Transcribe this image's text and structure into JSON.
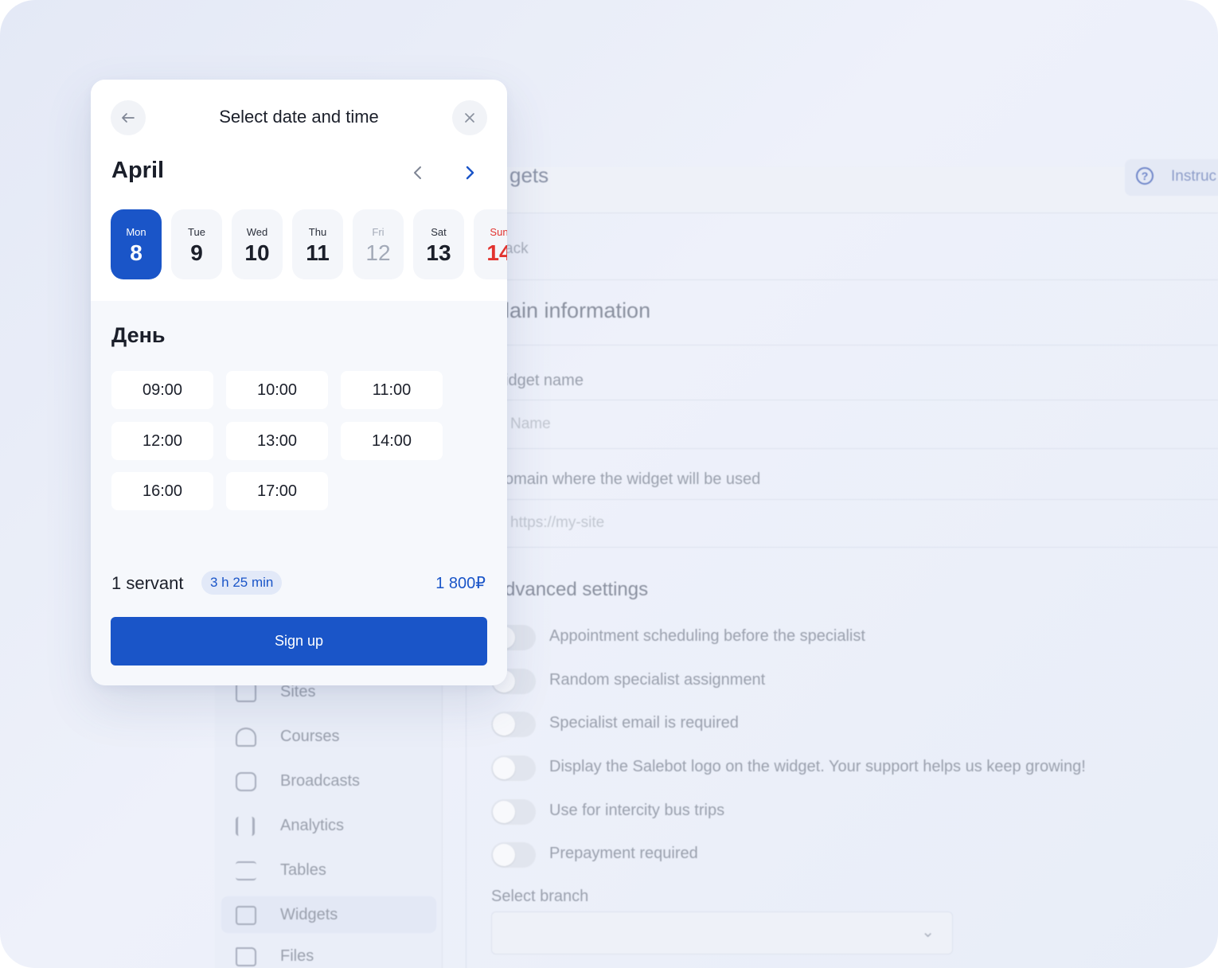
{
  "background": {
    "page_title": "gets",
    "help_label": "Instruc",
    "back_label": "ack",
    "main_section": "lain information",
    "widget_name_label": "idget name",
    "widget_name_placeholder": "Name",
    "domain_label": "omain where the widget will be used",
    "domain_placeholder": "https://my-site",
    "advanced_section": "dvanced settings",
    "toggles": [
      {
        "label": "Appointment scheduling before the specialist",
        "on": false
      },
      {
        "label": "Random specialist assignment",
        "on": false
      },
      {
        "label": "Specialist email is required",
        "on": false
      },
      {
        "label": "Display the Salebot logo on the widget. Your support helps us keep growing!",
        "on": false
      },
      {
        "label": "Use for intercity bus trips",
        "on": false
      },
      {
        "label": "Prepayment required",
        "on": false
      }
    ],
    "branch_label": "Select branch",
    "sidebar": [
      {
        "label": "Sites",
        "icon": "browser-icon"
      },
      {
        "label": "Courses",
        "icon": "graduation-cap-icon"
      },
      {
        "label": "Broadcasts",
        "icon": "calendar-icon"
      },
      {
        "label": "Analytics",
        "icon": "bar-chart-icon"
      },
      {
        "label": "Tables",
        "icon": "list-icon"
      },
      {
        "label": "Widgets",
        "icon": "widget-grid-icon",
        "active": true
      },
      {
        "label": "Files",
        "icon": "folder-icon"
      }
    ]
  },
  "modal": {
    "title": "Select date and time",
    "month": "April",
    "days": [
      {
        "name": "Mon",
        "num": "8",
        "state": "active"
      },
      {
        "name": "Tue",
        "num": "9",
        "state": "normal"
      },
      {
        "name": "Wed",
        "num": "10",
        "state": "normal"
      },
      {
        "name": "Thu",
        "num": "11",
        "state": "normal"
      },
      {
        "name": "Fri",
        "num": "12",
        "state": "disabled"
      },
      {
        "name": "Sat",
        "num": "13",
        "state": "normal"
      },
      {
        "name": "Sun",
        "num": "14",
        "state": "weekend"
      }
    ],
    "period": "День",
    "slots": [
      "09:00",
      "10:00",
      "11:00",
      "12:00",
      "13:00",
      "14:00",
      "16:00",
      "17:00"
    ],
    "servant": "1 servant",
    "duration": "3 h 25 min",
    "price": "1 800₽",
    "signup": "Sign up"
  },
  "colors": {
    "accent": "#1a55c8",
    "weekend": "#e2332f",
    "disabled": "#a3aab8"
  }
}
